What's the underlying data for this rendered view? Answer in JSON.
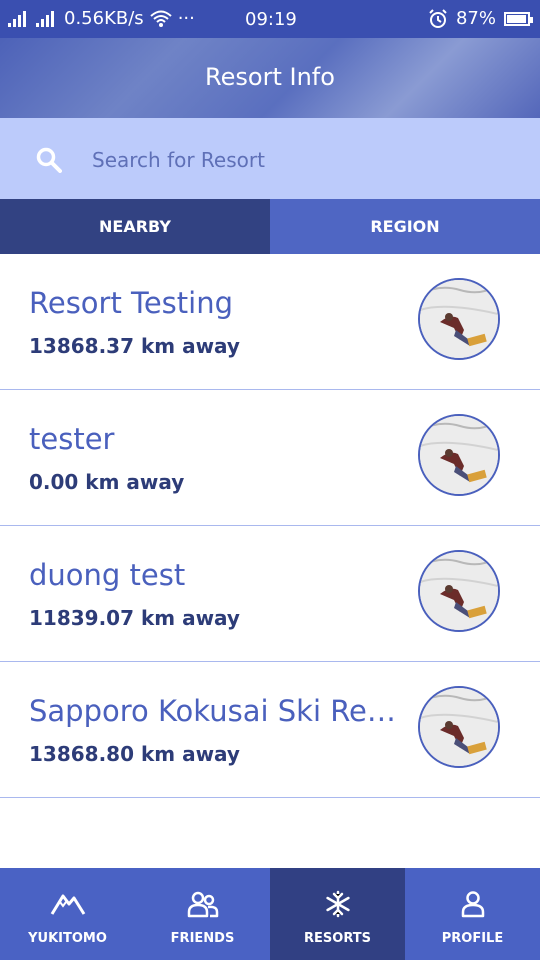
{
  "status_bar": {
    "network_speed": "0.56KB/s",
    "dots": "···",
    "time": "09:19",
    "battery": "87%"
  },
  "header": {
    "title": "Resort Info"
  },
  "search": {
    "placeholder": "Search for Resort"
  },
  "tabs": [
    {
      "label": "NEARBY",
      "active": true
    },
    {
      "label": "REGION",
      "active": false
    }
  ],
  "resorts": [
    {
      "name": "Resort Testing",
      "distance": "13868.37 km away"
    },
    {
      "name": "tester",
      "distance": "0.00 km away"
    },
    {
      "name": "duong test",
      "distance": "11839.07 km away"
    },
    {
      "name": "Sapporo Kokusai Ski Res...",
      "distance": "13868.80 km away"
    }
  ],
  "nav": [
    {
      "label": "YUKITOMO",
      "icon": "mountain-icon",
      "active": false
    },
    {
      "label": "FRIENDS",
      "icon": "friends-icon",
      "active": false
    },
    {
      "label": "RESORTS",
      "icon": "snowflake-icon",
      "active": true
    },
    {
      "label": "PROFILE",
      "icon": "profile-icon",
      "active": false
    }
  ],
  "colors": {
    "primary": "#4a62c4",
    "active": "#314083",
    "search_bg": "#bccbfb"
  }
}
